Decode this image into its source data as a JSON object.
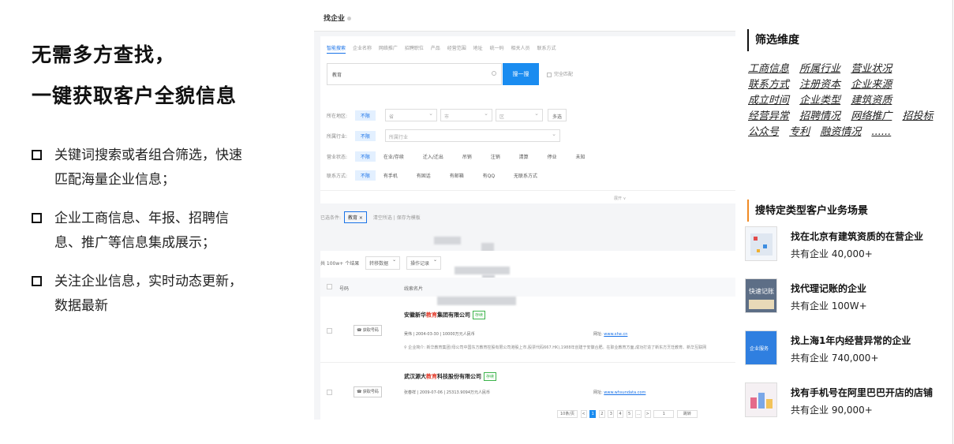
{
  "left": {
    "headline": [
      "无需多方查找，",
      "一键获取客户全貌信息"
    ],
    "bullets": [
      "关键词搜索或者组合筛选，快速匹配海量企业信息；",
      "企业工商信息、年报、招聘信息、推广等信息集成展示；",
      "关注企业信息，实时动态更新， 数据最新"
    ]
  },
  "screenshot": {
    "page_title": "找企业",
    "tabs": [
      "智能搜索",
      "企业名称",
      "网络推广",
      "招聘职位",
      "产品",
      "经营范围",
      "地址",
      "统一码",
      "相关人员",
      "联系方式"
    ],
    "active_tab": "智能搜索",
    "search_value": "教育",
    "search_button": "搜一搜",
    "exact_match": "完全匹配",
    "filters": {
      "region": {
        "label": "所在地区:",
        "tag": "不限",
        "selects": [
          "省",
          "市",
          "区"
        ],
        "more": "多选"
      },
      "industry": {
        "label": "所属行业:",
        "tag": "不限",
        "select": "所属行业"
      },
      "status": {
        "label": "营业状态:",
        "tag": "不限",
        "options": [
          "在业/存续",
          "迁入/迁出",
          "吊销",
          "注销",
          "清算",
          "停业",
          "未知"
        ]
      },
      "contact": {
        "label": "联系方式:",
        "tag": "不限",
        "options": [
          "有手机",
          "有固话",
          "有邮箱",
          "有QQ",
          "无联系方式"
        ]
      },
      "expand": "展开 ∨"
    },
    "selected": {
      "label": "已选条件:",
      "chip": "教育 ×",
      "clear": "清空所选",
      "save": "保存为模板"
    },
    "result_head": {
      "count": "共 100w+ 个结果",
      "transfer": "转移数据",
      "operation": "操作记录"
    },
    "table_header": {
      "col_number": "号码",
      "col_name": "线索名片"
    },
    "results": [
      {
        "call": "获取号码",
        "name_pre": "安徽新华",
        "name_hl": "教育",
        "name_post": "集团有限公司",
        "badge": "存续",
        "meta": "吴伟 | 2004-03-30 | 10000万元人民币",
        "site_label": "网址:",
        "site": "www.xhe.cn",
        "desc": "企业简介: 新华教育集团(母公司中国东方教育控股有限公司港股上市,股票代码667.HK),1988年创建于安徽合肥。在职业教育方面,成功打造了新东方烹饪教育、新华互联网"
      },
      {
        "call": "获取号码",
        "name_pre": "武汉源大",
        "name_hl": "教育",
        "name_post": "科技股份有限公司",
        "badge": "存续",
        "meta": "张春祥 | 2009-07-06 | 25313.9094万元人民币",
        "site_label": "网址:",
        "site": "www.whsundata.com",
        "desc": ""
      }
    ],
    "pager": {
      "size": "10条/页",
      "pages": [
        "<",
        "1",
        "2",
        "3",
        "4",
        "5",
        "...",
        ">"
      ],
      "jump": "1",
      "go": "跳转"
    }
  },
  "right": {
    "dim_title": "筛选维度",
    "dimensions": [
      "工商信息",
      "所属行业",
      "营业状况",
      "联系方式",
      "注册资本",
      "企业来源",
      "成立时间",
      "企业类型",
      "建筑资质",
      "经营异常",
      "招聘情况",
      "网络推广",
      "招投标",
      "公众号",
      "专利",
      "融资情况",
      "......"
    ],
    "scene_title": "搜特定类型客户业务场景",
    "scenes": [
      {
        "title": "找在北京有建筑资质的在营企业",
        "count": "共有企业 40,000+",
        "thumb": "map-thumbnail"
      },
      {
        "title": "找代理记账的企业",
        "count": "共有企业 100W+",
        "thumb": "accounting-thumbnail"
      },
      {
        "title": "找上海1年内经营异常的企业",
        "count": "共有企业 740,000+",
        "thumb": "service-thumbnail"
      },
      {
        "title": "找有手机号在阿里巴巴开店的店铺",
        "count": "共有企业 90,000+",
        "thumb": "shop-thumbnail"
      }
    ],
    "thumb_texts": {
      "accounting": "快速记账",
      "service": "企业服务"
    }
  },
  "colors": {
    "accent_blue": "#1a8cf0",
    "highlight_red": "#e23b2b",
    "orange_bar": "#f08a24",
    "badge_green": "#3bb34a"
  }
}
